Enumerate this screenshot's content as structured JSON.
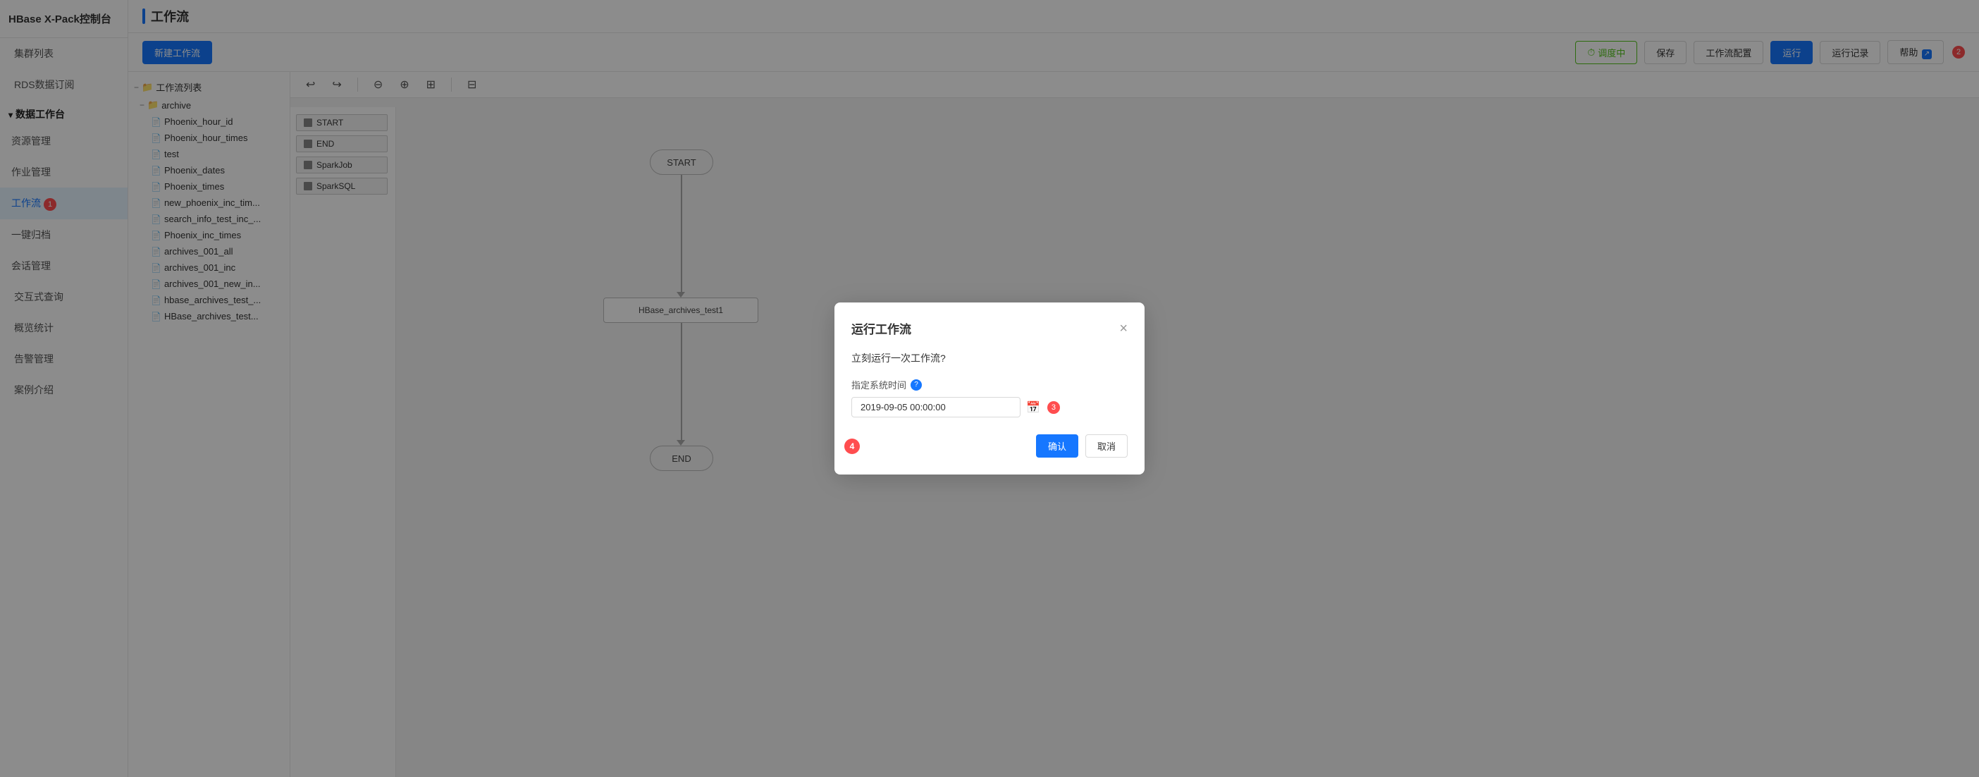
{
  "sidebar": {
    "logo": "HBase X-Pack控制台",
    "items": [
      {
        "id": "cluster-list",
        "label": "集群列表",
        "active": false
      },
      {
        "id": "rds-subscription",
        "label": "RDS数据订阅",
        "active": false
      },
      {
        "id": "data-workbench",
        "label": "数据工作台",
        "active": false,
        "group": true
      },
      {
        "id": "resource-mgmt",
        "label": "资源管理",
        "active": false,
        "indent": 1
      },
      {
        "id": "job-mgmt",
        "label": "作业管理",
        "active": false,
        "indent": 1
      },
      {
        "id": "workflow",
        "label": "工作流",
        "active": true,
        "indent": 1,
        "badge": "1"
      },
      {
        "id": "one-archive",
        "label": "一键归档",
        "active": false,
        "indent": 1
      },
      {
        "id": "session-mgmt",
        "label": "会话管理",
        "active": false,
        "indent": 1
      },
      {
        "id": "interactive-query",
        "label": "交互式查询",
        "active": false
      },
      {
        "id": "overview-stats",
        "label": "概览统计",
        "active": false
      },
      {
        "id": "alert-mgmt",
        "label": "告警管理",
        "active": false
      },
      {
        "id": "case-intro",
        "label": "案例介绍",
        "active": false
      }
    ]
  },
  "header": {
    "title": "工作流"
  },
  "toolbar": {
    "new_workflow_label": "新建工作流",
    "schedule_label": "调度中",
    "save_label": "保存",
    "workflow_config_label": "工作流配置",
    "run_label": "运行",
    "run_record_label": "运行记录",
    "help_label": "帮助",
    "badge": "2"
  },
  "tree": {
    "root_label": "工作流列表",
    "archive_folder": "archive",
    "items": [
      "Phoenix_hour_id",
      "Phoenix_hour_times",
      "test",
      "Phoenix_dates",
      "Phoenix_times",
      "new_phoenix_inc_tim...",
      "search_info_test_inc_...",
      "Phoenix_inc_times",
      "archives_001_all",
      "archives_001_inc",
      "archives_001_new_in...",
      "hbase_archives_test_...",
      "HBase_archives_test..."
    ]
  },
  "canvas_toolbar": {
    "undo": "↩",
    "redo": "↪",
    "zoom_out": "⊖",
    "zoom_in": "⊕",
    "fit": "⊞",
    "split": "⊟"
  },
  "node_list": {
    "items": [
      {
        "label": "START"
      },
      {
        "label": "END"
      },
      {
        "label": "SparkJob"
      },
      {
        "label": "SparkSQL"
      }
    ]
  },
  "diagram": {
    "start_label": "START",
    "end_label": "END",
    "hbase_label": "HBase_archives_test1"
  },
  "modal": {
    "title": "运行工作流",
    "close_icon": "×",
    "question": "立刻运行一次工作流?",
    "field_label": "指定系统时间",
    "datetime_value": "2019-09-05 00:00:00",
    "confirm_label": "确认",
    "cancel_label": "取消",
    "step_badge": "4",
    "help_icon": "?"
  }
}
